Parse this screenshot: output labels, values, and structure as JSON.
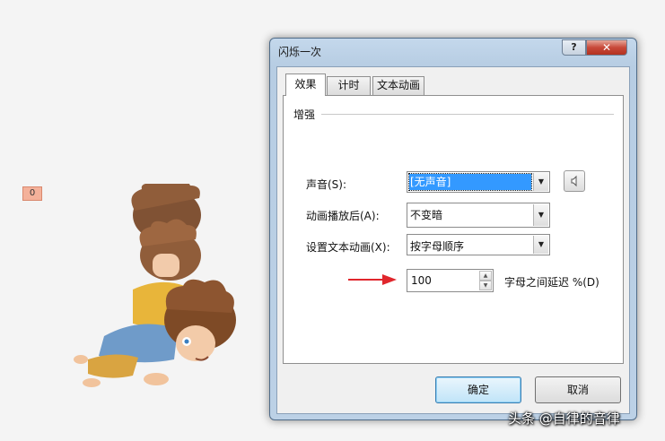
{
  "slide": {
    "animation_tag": "0"
  },
  "dialog": {
    "title": "闪烁一次",
    "help_label": "?",
    "close_label": "✕",
    "tabs": [
      {
        "label": "效果",
        "active": true
      },
      {
        "label": "计时",
        "active": false
      },
      {
        "label": "文本动画",
        "active": false
      }
    ],
    "group_title": "增强",
    "sound": {
      "label": "声音(S):",
      "value": "[无声音]",
      "icon": "speaker-icon"
    },
    "after_animation": {
      "label": "动画播放后(A):",
      "value": "不变暗"
    },
    "animate_text": {
      "label": "设置文本动画(X):",
      "value": "按字母顺序"
    },
    "delay": {
      "value": "100",
      "suffix_label": "字母之间延迟 %(D)"
    },
    "ok_label": "确定",
    "cancel_label": "取消"
  },
  "watermark": "头条 @自律的音律",
  "colors": {
    "selection": "#3399ff",
    "arrow": "#e0262c",
    "close_button": "#c8493a"
  }
}
